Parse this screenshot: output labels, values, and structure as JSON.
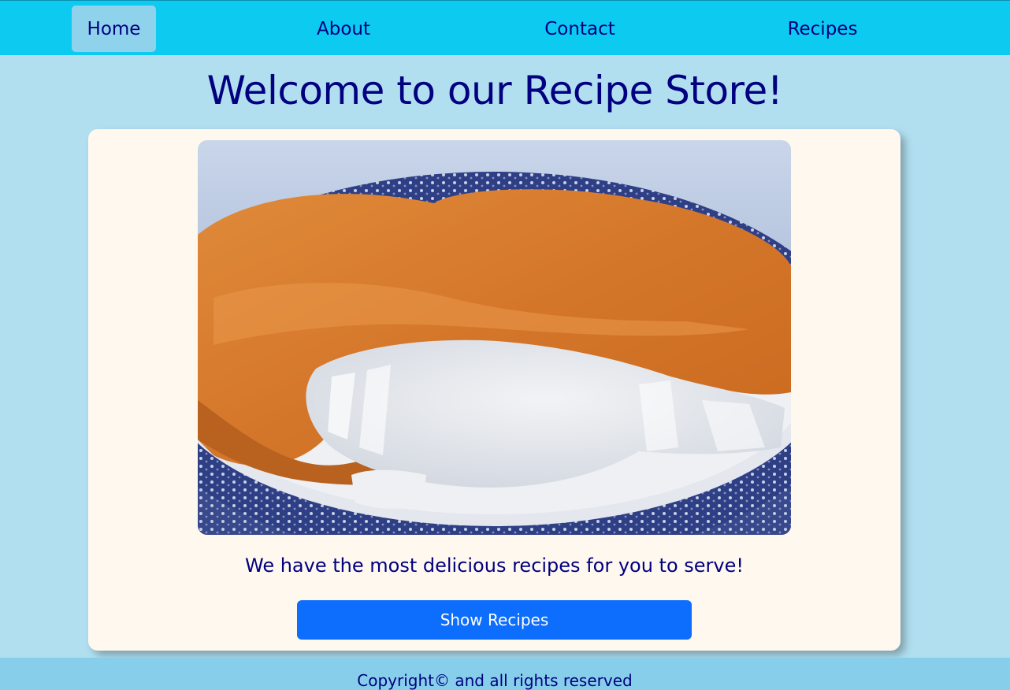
{
  "nav": {
    "items": [
      {
        "label": "Home",
        "active": true
      },
      {
        "label": "About",
        "active": false
      },
      {
        "label": "Contact",
        "active": false
      },
      {
        "label": "Recipes",
        "active": false
      }
    ]
  },
  "main": {
    "title": "Welcome to our Recipe Store!",
    "hero_image": "fried-fish-on-plate",
    "tagline": "We have the most delicious recipes for you to serve!",
    "button_label": "Show Recipes"
  },
  "footer": {
    "text": "Copyright© and all rights reserved"
  },
  "colors": {
    "navbar": "#0dcaf0",
    "background": "#b1dff0",
    "card": "#fef8ef",
    "text": "#000080",
    "button": "#0d6efd",
    "footer": "#87ceeb"
  }
}
